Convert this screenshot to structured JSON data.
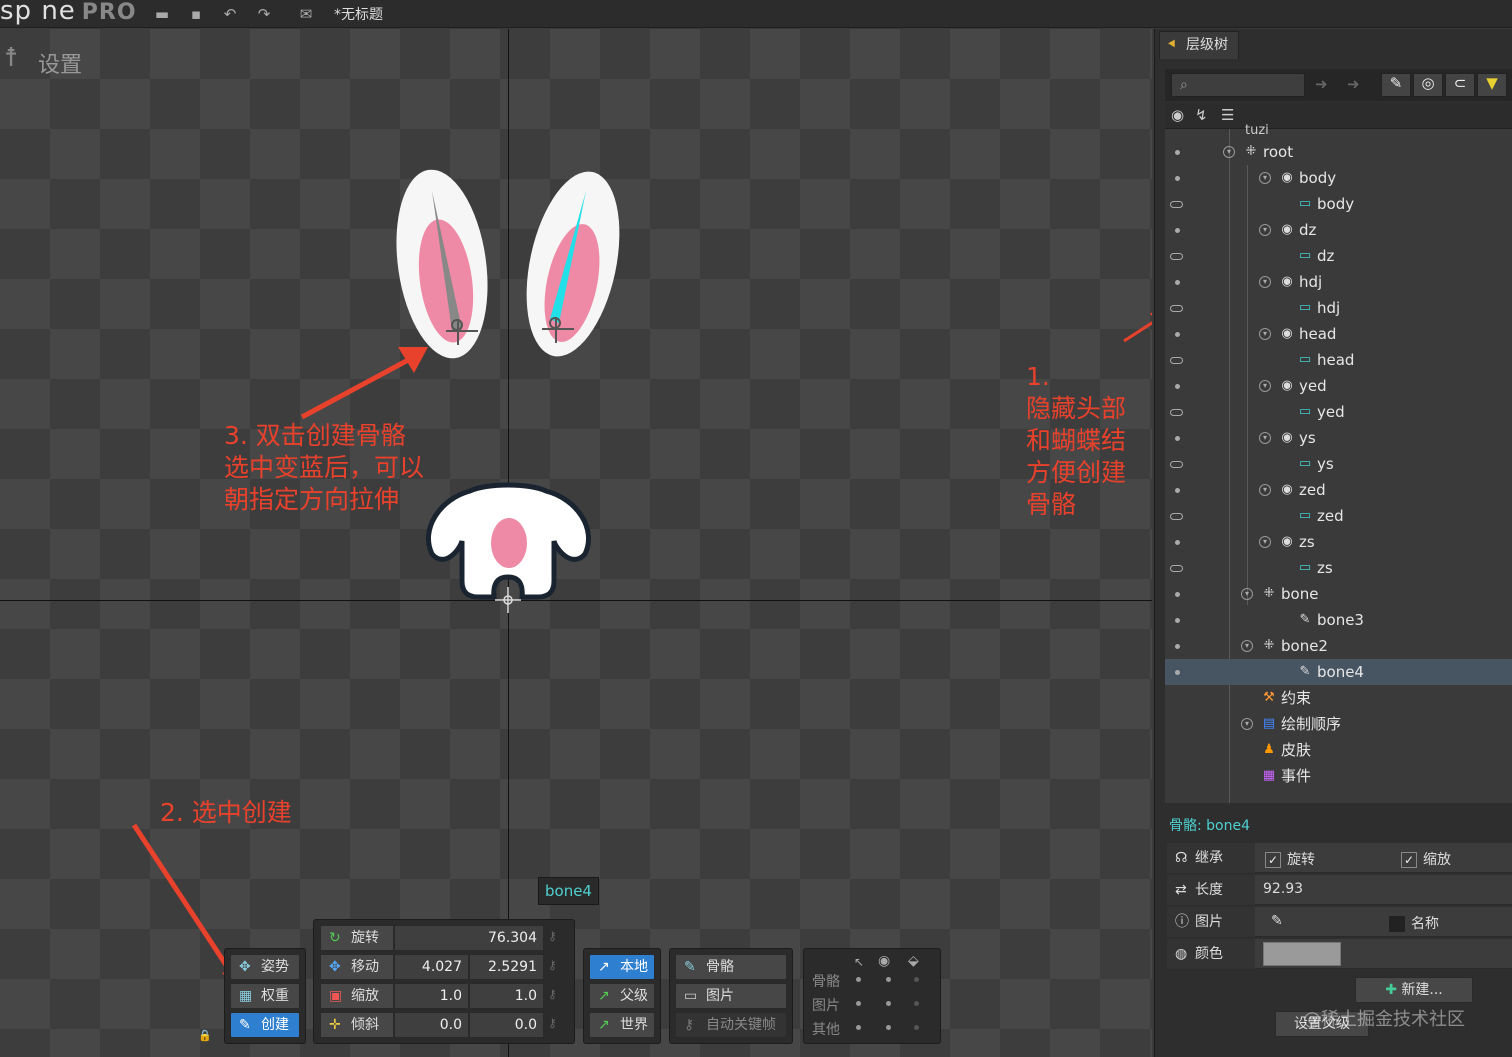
{
  "app": {
    "logo": "sp ne",
    "edition": "PRO",
    "document_title": "*无标题"
  },
  "toolbar": {
    "icons": [
      "folder-icon",
      "save-icon",
      "undo-icon",
      "redo-icon",
      "export-icon"
    ]
  },
  "viewport": {
    "settings_label": "设置",
    "annotations": {
      "note1": [
        "1.",
        "隐藏头部",
        "和蝴蝶结",
        "方便创建",
        "骨骼"
      ],
      "note2": "2. 选中创建",
      "note3": [
        "3. 双击创建骨骼",
        "选中变蓝后，可以",
        "朝指定方向拉伸"
      ]
    },
    "bone_tooltip": "bone4",
    "accent_colors": {
      "annotation": "#e8412c",
      "selected_bone": "#22e0e8"
    }
  },
  "mode_panel": {
    "pose": "姿势",
    "weights": "权重",
    "create": "创建"
  },
  "transform_panel": {
    "rotate": {
      "label": "旋转",
      "value": "76.304"
    },
    "translate": {
      "label": "移动",
      "x": "4.027",
      "y": "2.5291"
    },
    "scale": {
      "label": "缩放",
      "x": "1.0",
      "y": "1.0"
    },
    "shear": {
      "label": "倾斜",
      "x": "0.0",
      "y": "0.0"
    }
  },
  "axes_panel": {
    "local": "本地",
    "parent": "父级",
    "world": "世界"
  },
  "compensate_panel": {
    "bones": "骨骼",
    "images": "图片",
    "auto_key": "自动关键帧"
  },
  "options_panel": {
    "bones": "骨骼",
    "images": "图片",
    "others": "其他"
  },
  "hierarchy": {
    "tab_label": "层级树",
    "search_placeholder": "",
    "skeleton_name": "tuzi",
    "nodes": [
      {
        "label": "root",
        "type": "bone"
      },
      {
        "label": "body",
        "type": "slot"
      },
      {
        "label": "body",
        "type": "attachment"
      },
      {
        "label": "dz",
        "type": "slot"
      },
      {
        "label": "dz",
        "type": "attachment"
      },
      {
        "label": "hdj",
        "type": "slot"
      },
      {
        "label": "hdj",
        "type": "attachment"
      },
      {
        "label": "head",
        "type": "slot"
      },
      {
        "label": "head",
        "type": "attachment"
      },
      {
        "label": "yed",
        "type": "slot"
      },
      {
        "label": "yed",
        "type": "attachment"
      },
      {
        "label": "ys",
        "type": "slot"
      },
      {
        "label": "ys",
        "type": "attachment"
      },
      {
        "label": "zed",
        "type": "slot"
      },
      {
        "label": "zed",
        "type": "attachment"
      },
      {
        "label": "zs",
        "type": "slot"
      },
      {
        "label": "zs",
        "type": "attachment"
      },
      {
        "label": "bone",
        "type": "bone"
      },
      {
        "label": "bone3",
        "type": "bone-leaf"
      },
      {
        "label": "bone2",
        "type": "bone"
      },
      {
        "label": "bone4",
        "type": "bone-leaf"
      },
      {
        "label": "约束",
        "type": "constraints"
      },
      {
        "label": "绘制顺序",
        "type": "draw-order"
      },
      {
        "label": "皮肤",
        "type": "skins"
      },
      {
        "label": "事件",
        "type": "events"
      }
    ],
    "selected": "bone4"
  },
  "properties": {
    "caption": "骨骼: bone4",
    "inherit": "继承",
    "inherit_rotation": "旋转",
    "inherit_scale": "缩放",
    "length_label": "长度",
    "length_value": "92.93",
    "image_label": "图片",
    "name_label": "名称",
    "color_label": "颜色",
    "new_button": "新建...",
    "set_parent_button": "设置父级",
    "watermark": "@稀土掘金技术社区"
  }
}
